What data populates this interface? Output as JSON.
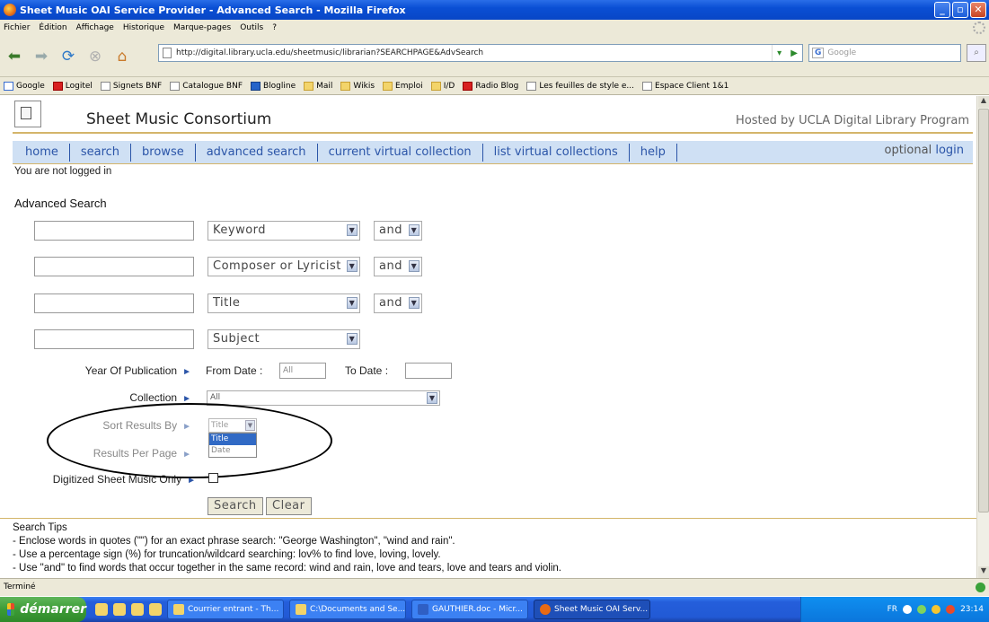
{
  "window": {
    "title": "Sheet Music OAI Service Provider - Advanced Search - Mozilla Firefox",
    "minimize": "_",
    "maximize": "▫",
    "close": "✕"
  },
  "menu": [
    "Fichier",
    "Édition",
    "Affichage",
    "Historique",
    "Marque-pages",
    "Outils",
    "?"
  ],
  "browser": {
    "url": "http://digital.library.ucla.edu/sheetmusic/librarian?SEARCHPAGE&AdvSearch",
    "search_placeholder": "Google",
    "search_engine": "G"
  },
  "bookmarks": [
    {
      "label": "Google",
      "icon": "google-icon"
    },
    {
      "label": "Logitel",
      "icon": "red-flag-icon"
    },
    {
      "label": "Signets BNF",
      "icon": "page-icon"
    },
    {
      "label": "Catalogue BNF",
      "icon": "page-icon"
    },
    {
      "label": "Blogline",
      "icon": "bloglines-icon"
    },
    {
      "label": "Mail",
      "icon": "folder-icon"
    },
    {
      "label": "Wikis",
      "icon": "folder-icon"
    },
    {
      "label": "Emploi",
      "icon": "folder-icon"
    },
    {
      "label": "I/D",
      "icon": "folder-icon"
    },
    {
      "label": "Radio Blog",
      "icon": "radio-icon"
    },
    {
      "label": "Les feuilles de style e...",
      "icon": "css-icon"
    },
    {
      "label": "Espace Client 1&1",
      "icon": "page-icon"
    }
  ],
  "site": {
    "title": "Sheet Music Consortium",
    "hosted_by": "Hosted by UCLA Digital Library Program",
    "nav_tabs": [
      "home",
      "search",
      "browse",
      "advanced search",
      "current virtual collection",
      "list virtual collections",
      "help"
    ],
    "optional_label": "optional",
    "login_label": "login",
    "login_status": "You are not logged in"
  },
  "search": {
    "heading": "Advanced Search",
    "rows": [
      {
        "field": "Keyword",
        "bool": "and"
      },
      {
        "field": "Composer or Lyricist",
        "bool": "and"
      },
      {
        "field": "Title",
        "bool": "and"
      },
      {
        "field": "Subject",
        "bool": ""
      }
    ],
    "year_label": "Year Of Publication",
    "from_label": "From Date :",
    "from_value": "All",
    "to_label": "To Date :",
    "to_value": "",
    "collection_label": "Collection",
    "collection_value": "All",
    "sort_label": "Sort Results By",
    "sort_value": "Title",
    "sort_options": [
      "Title",
      "Date"
    ],
    "per_page_label": "Results Per Page",
    "digitized_label": "Digitized Sheet Music Only",
    "digitized_checked": false,
    "search_button": "Search",
    "clear_button": "Clear"
  },
  "tips": {
    "heading": "Search Tips",
    "lines": [
      "- Enclose words in quotes (\"\") for an exact phrase search: \"George Washington\", \"wind and rain\".",
      "- Use a percentage sign (%) for truncation/wildcard searching: lov% to find love, loving, lovely.",
      "- Use \"and\" to find words that occur together in the same record: wind and rain, love and tears, love and tears and violin."
    ]
  },
  "statusbar": {
    "text": "Terminé"
  },
  "taskbar": {
    "start": "démarrer",
    "tasks": [
      "Courrier entrant - Th...",
      "C:\\Documents and Se...",
      "GAUTHIER.doc - Micr...",
      "Sheet Music OAI Serv..."
    ],
    "lang": "FR",
    "clock": "23:14"
  }
}
